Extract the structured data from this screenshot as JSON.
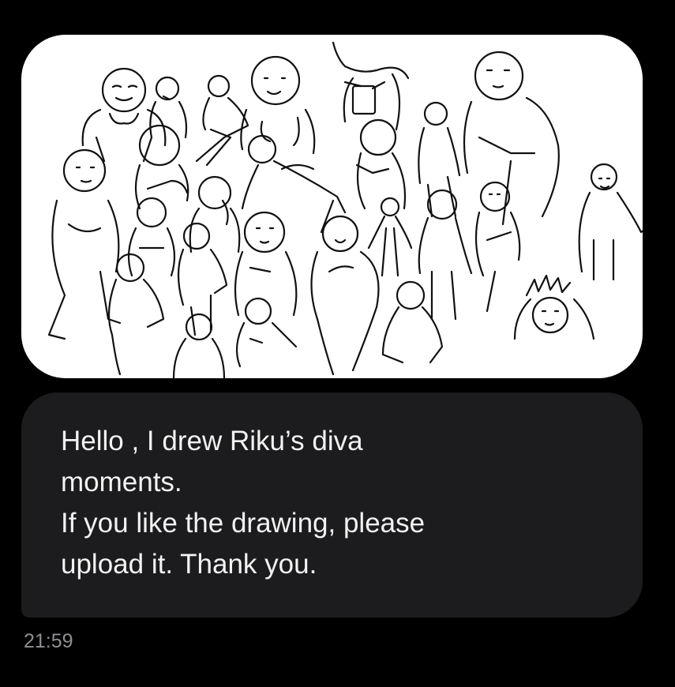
{
  "message": {
    "image": {
      "description_icon": "sketch-image"
    },
    "text": "Hello , I drew Riku’s diva\nmoments.\nIf you like the drawing, please\nupload it. Thank you.",
    "timestamp": "21:59"
  },
  "colors": {
    "background": "#000000",
    "bubble": "#1c1c1e",
    "text": "#f2f2f2",
    "timestamp": "#8e8e93"
  }
}
